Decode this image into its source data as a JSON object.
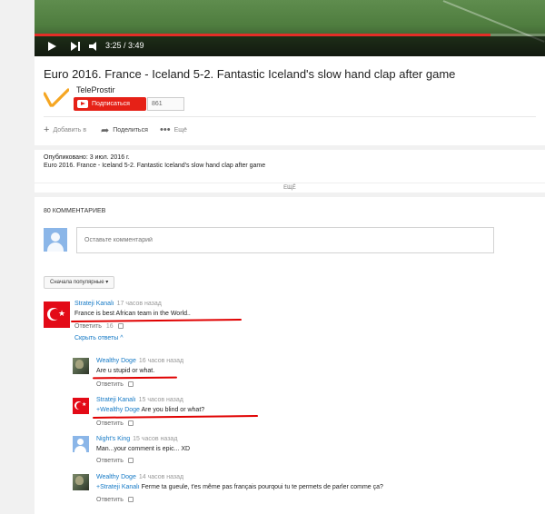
{
  "player": {
    "time": "3:25 / 3:49",
    "progress_fraction": 0.894
  },
  "video": {
    "title": "Euro 2016. France - Iceland 5-2. Fantastic Iceland's slow hand clap after game",
    "channel": "TeleProstir",
    "subscribe_label": "Подписаться",
    "subscriber_count": "861",
    "actions": {
      "add": "Добавить в",
      "share": "Поделиться",
      "more": "Ещё"
    }
  },
  "description": {
    "published": "Опубликовано: 3 июл. 2016 г.",
    "text": "Euro 2016. France - Iceland 5-2. Fantastic Iceland's slow hand clap after game",
    "show_more": "ЕЩЁ"
  },
  "comments": {
    "count_label": "80 КОММЕНТАРИЕВ",
    "input_placeholder": "Оставьте комментарий",
    "sort_label": "Сначала популярные",
    "hide_replies_label": "Скрыть ответы",
    "reply_label": "Ответить",
    "items": [
      {
        "author": "Strateji Kanalı",
        "time": "17 часов назад",
        "text": "France is best African team in the World..",
        "likes": "16"
      },
      {
        "author": "Wealthy Doge",
        "time": "16 часов назад",
        "text": "Are u stupid or what."
      },
      {
        "author": "Strateji Kanalı",
        "time": "15 часов назад",
        "mention": "+Wealthy Doge",
        "text": "Are you blind or what?"
      },
      {
        "author": "Night's King",
        "time": "15 часов назад",
        "text": "Man...your comment is epic... XD"
      },
      {
        "author": "Wealthy Doge",
        "time": "14 часов назад",
        "mention": "+Strateji Kanalı",
        "text": "Ferme ta gueule, t'es même pas français pourqoui tu te permets de parler comme ça?"
      }
    ]
  },
  "colors": {
    "accent_link": "#167ac6",
    "subscribe_red": "#e62117",
    "annotation_red": "#e00000",
    "flag_red": "#e30a17"
  }
}
